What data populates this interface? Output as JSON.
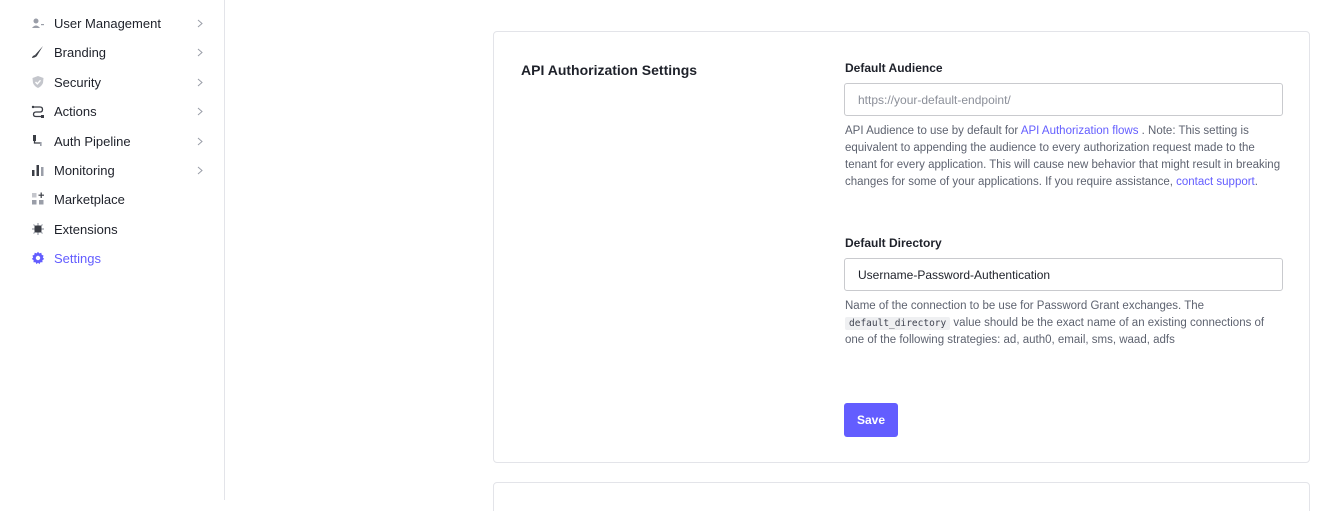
{
  "sidebar": {
    "items": [
      {
        "label": "User Management",
        "icon": "users-icon",
        "chevron": "›"
      },
      {
        "label": "Branding",
        "icon": "brush-icon",
        "chevron": "›"
      },
      {
        "label": "Security",
        "icon": "shield-icon",
        "chevron": "›"
      },
      {
        "label": "Actions",
        "icon": "actions-icon",
        "chevron": "›"
      },
      {
        "label": "Auth Pipeline",
        "icon": "pipeline-icon",
        "chevron": "›"
      },
      {
        "label": "Monitoring",
        "icon": "bar-chart-icon",
        "chevron": "›"
      },
      {
        "label": "Marketplace",
        "icon": "grid-plus-icon"
      },
      {
        "label": "Extensions",
        "icon": "puzzle-icon"
      },
      {
        "label": "Settings",
        "icon": "gear-icon",
        "active": true
      }
    ]
  },
  "api_settings": {
    "title": "API Authorization Settings",
    "default_audience": {
      "label": "Default Audience",
      "value": "",
      "placeholder": "https://your-default-endpoint/",
      "help_prefix": "API Audience to use by default for ",
      "help_link": "API Authorization flows",
      "help_middle": " . Note: This setting is equivalent to appending the audience to every authorization request made to the tenant for every application. This will cause new behavior that might result in breaking changes for some of your applications. If you require assistance, ",
      "help_link2": "contact support",
      "help_suffix": "."
    },
    "default_directory": {
      "label": "Default Directory",
      "value": "Username-Password-Authentication",
      "help_prefix": "Name of the connection to be use for Password Grant exchanges. The ",
      "help_code": "default_directory",
      "help_suffix": " value should be the exact name of an existing connections of one of the following strategies: ad, auth0, email, sms, waad, adfs"
    },
    "save_label": "Save"
  },
  "colors": {
    "accent": "#635dff",
    "border": "#e3e4e9",
    "text": "#1e212a",
    "muted": "#5e6370"
  }
}
